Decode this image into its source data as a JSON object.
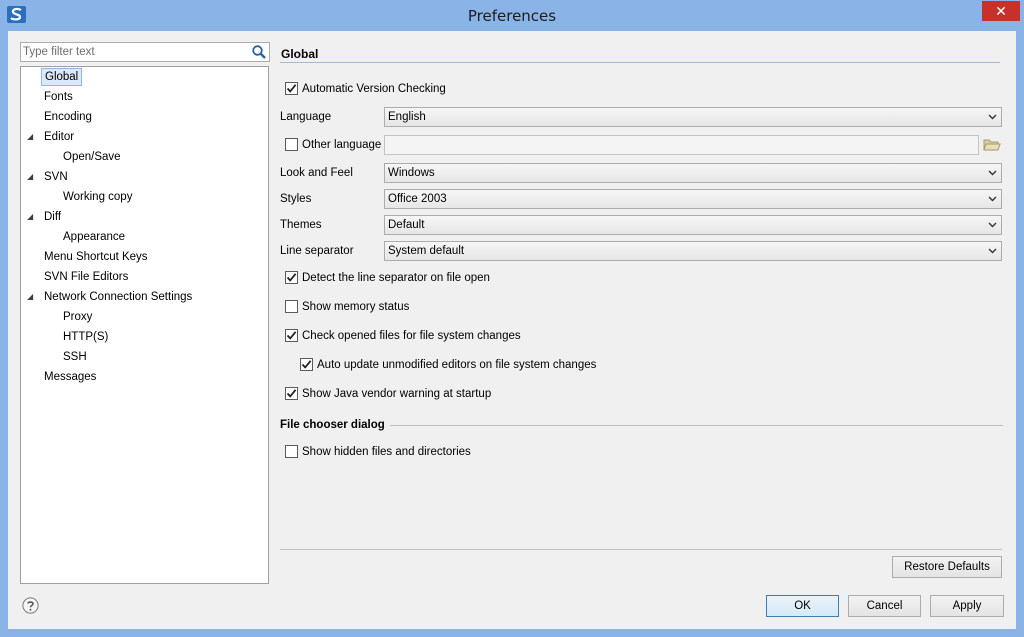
{
  "window": {
    "title": "Preferences",
    "close_glyph": "✕"
  },
  "filter": {
    "placeholder": "Type filter text"
  },
  "tree": {
    "items": [
      {
        "label": "Global",
        "level": 0,
        "expanded": null,
        "selected": true
      },
      {
        "label": "Fonts",
        "level": 0,
        "expanded": null
      },
      {
        "label": "Encoding",
        "level": 0,
        "expanded": null
      },
      {
        "label": "Editor",
        "level": 0,
        "expanded": true
      },
      {
        "label": "Open/Save",
        "level": 1,
        "expanded": null
      },
      {
        "label": "SVN",
        "level": 0,
        "expanded": true
      },
      {
        "label": "Working copy",
        "level": 1,
        "expanded": null
      },
      {
        "label": "Diff",
        "level": 0,
        "expanded": true
      },
      {
        "label": "Appearance",
        "level": 1,
        "expanded": null
      },
      {
        "label": "Menu Shortcut Keys",
        "level": 0,
        "expanded": null
      },
      {
        "label": "SVN File Editors",
        "level": 0,
        "expanded": null
      },
      {
        "label": "Network Connection Settings",
        "level": 0,
        "expanded": true
      },
      {
        "label": "Proxy",
        "level": 1,
        "expanded": null
      },
      {
        "label": "HTTP(S)",
        "level": 1,
        "expanded": null
      },
      {
        "label": "SSH",
        "level": 1,
        "expanded": null
      },
      {
        "label": "Messages",
        "level": 0,
        "expanded": null
      }
    ]
  },
  "global": {
    "title": "Global",
    "auto_version_check": {
      "label": "Automatic Version Checking",
      "checked": true
    },
    "language": {
      "label": "Language",
      "value": "English"
    },
    "other_language": {
      "label": "Other language",
      "checked": false,
      "value": ""
    },
    "look_and_feel": {
      "label": "Look and Feel",
      "value": "Windows"
    },
    "styles": {
      "label": "Styles",
      "value": "Office 2003"
    },
    "themes": {
      "label": "Themes",
      "value": "Default"
    },
    "line_separator": {
      "label": "Line separator",
      "value": "System default"
    },
    "detect_line_sep": {
      "label": "Detect the line separator on file open",
      "checked": true
    },
    "show_memory": {
      "label": "Show memory status",
      "checked": false
    },
    "check_opened": {
      "label": "Check opened files for file system changes",
      "checked": true
    },
    "auto_update": {
      "label": "Auto update unmodified editors on file system changes",
      "checked": true
    },
    "java_vendor": {
      "label": "Show Java vendor warning at startup",
      "checked": true
    }
  },
  "file_chooser": {
    "title": "File chooser dialog",
    "show_hidden": {
      "label": "Show hidden files and directories",
      "checked": false
    }
  },
  "buttons": {
    "restore_defaults": "Restore Defaults",
    "ok": "OK",
    "cancel": "Cancel",
    "apply": "Apply"
  },
  "colors": {
    "titlebar": "#8ab4e8",
    "close": "#c7312b",
    "selection": "#dbe8f8"
  }
}
